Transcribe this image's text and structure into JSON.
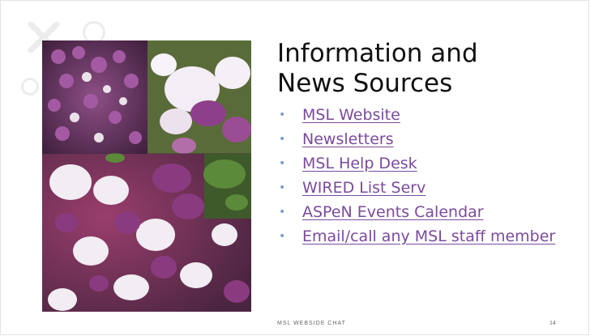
{
  "slide": {
    "title_line1": "Information and",
    "title_line2": "News Sources",
    "links": [
      {
        "label": "MSL Website"
      },
      {
        "label": "Newsletters"
      },
      {
        "label": "MSL Help Desk"
      },
      {
        "label": "WIRED List Serv"
      },
      {
        "label": "ASPeN Events Calendar"
      },
      {
        "label": "Email/call any MSL staff member"
      }
    ],
    "footer": "MSL WEBSIDE CHAT",
    "page_number": "14"
  },
  "colors": {
    "link": "#7b4a9c",
    "bullet": "#7f9cc6",
    "title": "#111111"
  },
  "image": {
    "description_icon": "lilac-photo-collage"
  }
}
